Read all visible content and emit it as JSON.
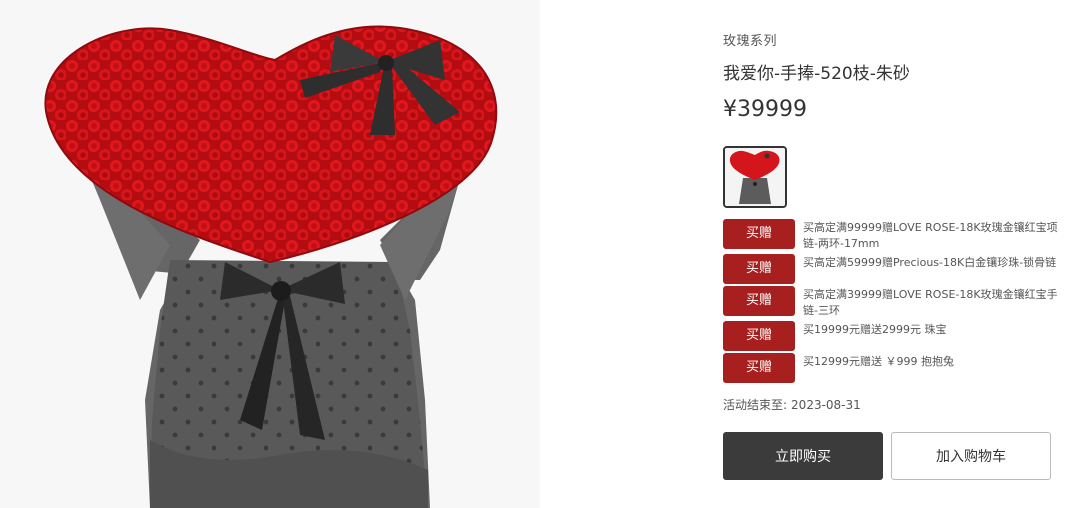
{
  "product": {
    "category": "玫瑰系列",
    "title": "我爱你-手捧-520枝-朱砂",
    "price": "¥39999",
    "main_image": "red-rose-heart-bouquet-image",
    "thumbnail": "red-rose-heart-bouquet-thumbnail"
  },
  "promotions": [
    {
      "badge": "买赠",
      "text": "买高定满99999赠LOVE ROSE-18K玫瑰金镶红宝项链-两环-17mm"
    },
    {
      "badge": "买赠",
      "text": "买高定满59999赠Precious-18K白金镶珍珠-锁骨链"
    },
    {
      "badge": "买赠",
      "text": "买高定满39999赠LOVE ROSE-18K玫瑰金镶红宝手链-三环"
    },
    {
      "badge": "买赠",
      "text": "买19999元赠送2999元 珠宝"
    },
    {
      "badge": "买赠",
      "text": "买12999元赠送 ￥999 抱抱兔"
    }
  ],
  "activity": {
    "label": "活动结束至:",
    "end_date": "2023-08-31"
  },
  "actions": {
    "buy_now": "立即购买",
    "add_to_cart": "加入购物车"
  },
  "colors": {
    "promo_badge": "#a7201f",
    "buy_button": "#3b3b3b",
    "rose": "#d8141a",
    "wrap": "#5a5a5a"
  }
}
